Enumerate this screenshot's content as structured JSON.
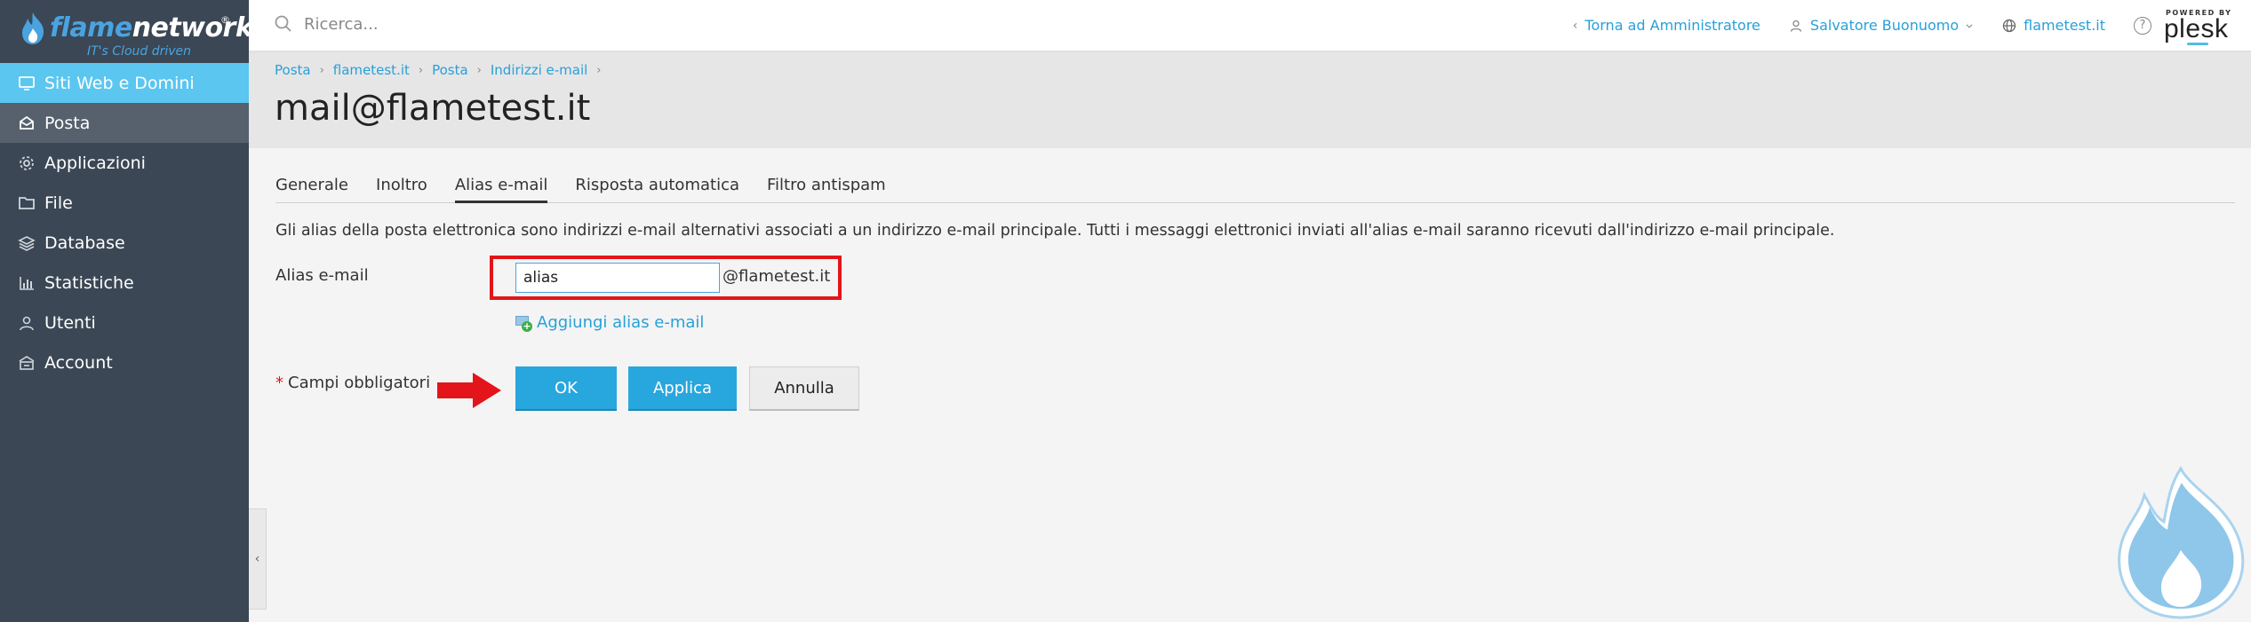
{
  "brand": {
    "logo_part1": "flame",
    "logo_part2": "networks",
    "logo_reg": "®",
    "tagline": "IT's Cloud driven",
    "accent_color": "#4aa3e0"
  },
  "sidebar": {
    "items": [
      {
        "label": "Siti Web e Domini",
        "icon": "monitor-icon",
        "state": "active"
      },
      {
        "label": "Posta",
        "icon": "mail-icon",
        "state": "selected"
      },
      {
        "label": "Applicazioni",
        "icon": "gear-icon",
        "state": ""
      },
      {
        "label": "File",
        "icon": "folder-icon",
        "state": ""
      },
      {
        "label": "Database",
        "icon": "database-icon",
        "state": ""
      },
      {
        "label": "Statistiche",
        "icon": "bar-chart-icon",
        "state": ""
      },
      {
        "label": "Utenti",
        "icon": "user-icon",
        "state": ""
      },
      {
        "label": "Account",
        "icon": "account-icon",
        "state": ""
      }
    ],
    "collapse_glyph": "‹"
  },
  "topbar": {
    "search_placeholder": "Ricerca...",
    "back_link": "Torna ad Amministratore",
    "back_glyph": "‹",
    "user_name": "Salvatore Buonuomo",
    "domain_link": "flametest.it",
    "help_glyph": "?",
    "powered_by": "POWERED BY",
    "plesk_word": "plesk"
  },
  "header": {
    "breadcrumb": [
      "Posta",
      "flametest.it",
      "Posta",
      "Indirizzi e-mail"
    ],
    "breadcrumb_sep": "›",
    "title": "mail@flametest.it"
  },
  "tabs": [
    {
      "label": "Generale",
      "active": false
    },
    {
      "label": "Inoltro",
      "active": false
    },
    {
      "label": "Alias e-mail",
      "active": true
    },
    {
      "label": "Risposta automatica",
      "active": false
    },
    {
      "label": "Filtro antispam",
      "active": false
    }
  ],
  "form": {
    "description": "Gli alias della posta elettronica sono indirizzi e-mail alternativi associati a un indirizzo e-mail principale. Tutti i messaggi elettronici inviati all'alias e-mail saranno ricevuti dall'indirizzo e-mail principale.",
    "alias_label": "Alias e-mail",
    "alias_value": "alias",
    "alias_domain": "@flametest.it",
    "add_alias_label": "Aggiungi alias e-mail",
    "add_alias_plus": "+",
    "required_star": "*",
    "required_note": "Campi obbligatori",
    "highlight_color": "#e3151a"
  },
  "buttons": {
    "ok": "OK",
    "apply": "Applica",
    "cancel": "Annulla"
  }
}
